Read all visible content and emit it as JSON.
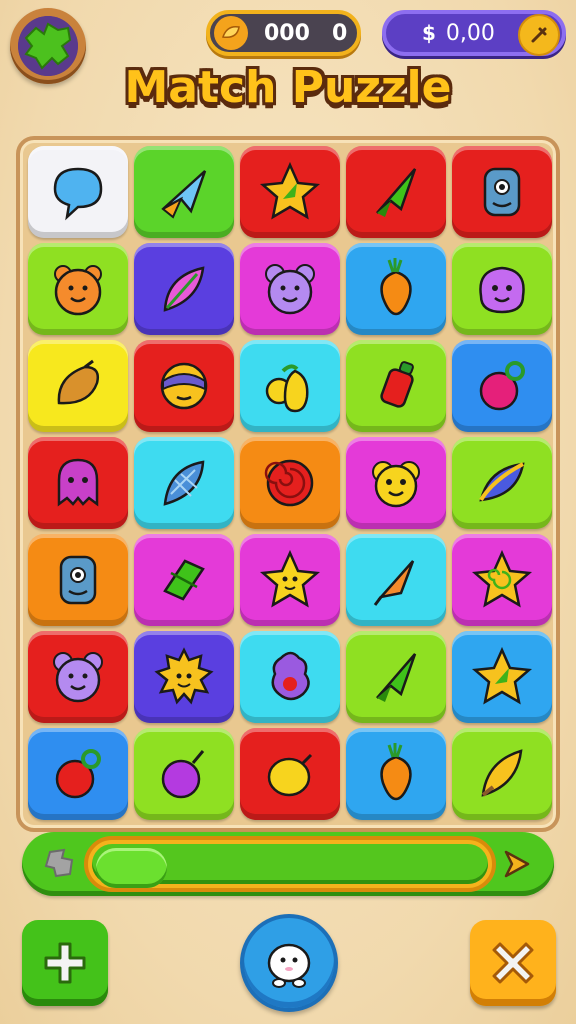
{
  "header": {
    "coins_value": "000",
    "coins_extra": "0",
    "cash_symbol": "$",
    "cash_value": "0,00"
  },
  "title": "Match Puzzle",
  "board": {
    "rows": [
      [
        {
          "color": "#f3f3f7",
          "icon": "speech-bubble-icon"
        },
        {
          "color": "#5bd42a",
          "icon": "paper-plane-icon"
        },
        {
          "color": "#e5201e",
          "icon": "star-leaf-icon"
        },
        {
          "color": "#e5201e",
          "icon": "green-arrow-icon"
        },
        {
          "color": "#e5201e",
          "icon": "robot-monster-icon"
        }
      ],
      [
        {
          "color": "#8fe022",
          "icon": "bear-face-icon"
        },
        {
          "color": "#5a3fe0",
          "icon": "feather-leaf-icon"
        },
        {
          "color": "#e43ad8",
          "icon": "mouse-face-icon"
        },
        {
          "color": "#2fa6f0",
          "icon": "carrot-icon"
        },
        {
          "color": "#8fe022",
          "icon": "blob-monster-icon"
        }
      ],
      [
        {
          "color": "#f7e81e",
          "icon": "seed-icon"
        },
        {
          "color": "#e5201e",
          "icon": "ninja-face-icon"
        },
        {
          "color": "#3edbf0",
          "icon": "pear-icon"
        },
        {
          "color": "#8fe022",
          "icon": "red-bottle-icon"
        },
        {
          "color": "#2f8ef0",
          "icon": "berry-icon"
        }
      ],
      [
        {
          "color": "#e5201e",
          "icon": "ghost-monster-icon"
        },
        {
          "color": "#3edbf0",
          "icon": "leaf-net-icon"
        },
        {
          "color": "#f58b14",
          "icon": "swirl-icon"
        },
        {
          "color": "#e43ad8",
          "icon": "flower-face-icon"
        },
        {
          "color": "#8fe022",
          "icon": "blue-leaf-icon"
        }
      ],
      [
        {
          "color": "#f58b14",
          "icon": "robot-monster-icon"
        },
        {
          "color": "#e43ad8",
          "icon": "green-leaves-icon"
        },
        {
          "color": "#e43ad8",
          "icon": "star-face-icon"
        },
        {
          "color": "#3edbf0",
          "icon": "cone-icon"
        },
        {
          "color": "#e43ad8",
          "icon": "swirl-star-icon"
        }
      ],
      [
        {
          "color": "#e5201e",
          "icon": "mouse-face-icon"
        },
        {
          "color": "#5a3fe0",
          "icon": "sun-face-icon"
        },
        {
          "color": "#3edbf0",
          "icon": "purple-blob-icon"
        },
        {
          "color": "#8fe022",
          "icon": "green-arrow-icon"
        },
        {
          "color": "#2fa6f0",
          "icon": "star-leaf-icon"
        }
      ],
      [
        {
          "color": "#2f8ef0",
          "icon": "cherry-bomb-icon"
        },
        {
          "color": "#8fe022",
          "icon": "purple-berry-icon"
        },
        {
          "color": "#e5201e",
          "icon": "lemon-icon"
        },
        {
          "color": "#2fa6f0",
          "icon": "carrot-icon"
        },
        {
          "color": "#8fe022",
          "icon": "pencil-leaf-icon"
        }
      ]
    ]
  },
  "progress": {
    "value": 0.18,
    "start_icon": "puzzle-piece-icon",
    "end_icon": "arrow-right-icon"
  },
  "buttons": {
    "left_icon": "plus-icon",
    "center_icon": "character-icon",
    "right_icon": "close-icon"
  }
}
